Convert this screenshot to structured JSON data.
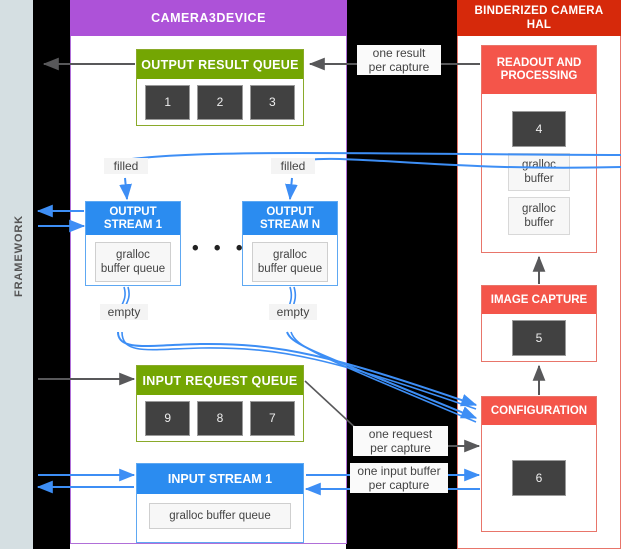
{
  "framework": {
    "label": "FRAMEWORK"
  },
  "camera3device": {
    "title": "CAMERA3DEVICE",
    "output_result_queue": {
      "title": "OUTPUT RESULT QUEUE",
      "slots": [
        "1",
        "2",
        "3"
      ]
    },
    "input_request_queue": {
      "title": "INPUT REQUEST QUEUE",
      "slots": [
        "9",
        "8",
        "7"
      ]
    },
    "output_stream_1": {
      "title_line1": "OUTPUT",
      "title_line2": "STREAM 1",
      "buffer_line1": "gralloc",
      "buffer_line2": "buffer queue"
    },
    "output_stream_n": {
      "title_line1": "OUTPUT",
      "title_line2": "STREAM N",
      "buffer_line1": "gralloc",
      "buffer_line2": "buffer queue"
    },
    "input_stream_1": {
      "title": "INPUT STREAM 1",
      "buffer": "gralloc buffer queue"
    },
    "ellipsis": "• • •"
  },
  "hal": {
    "title_line1": "BINDERIZED CAMERA",
    "title_line2": "HAL",
    "readout": {
      "title_line1": "READOUT AND",
      "title_line2": "PROCESSING",
      "slot": "4",
      "buffer_1_line1": "gralloc",
      "buffer_1_line2": "buffer",
      "buffer_2_line1": "gralloc",
      "buffer_2_line2": "buffer"
    },
    "image_capture": {
      "title": "IMAGE CAPTURE",
      "slot": "5"
    },
    "configuration": {
      "title": "CONFIGURATION",
      "slot": "6"
    }
  },
  "edge_labels": {
    "one_result_line1": "one result",
    "one_result_line2": "per capture",
    "one_request_line1": "one request",
    "one_request_line2": "per capture",
    "one_input_buffer_line1": "one input buffer",
    "one_input_buffer_line2": "per capture",
    "filled_left": "filled",
    "filled_right": "filled",
    "empty_left": "empty",
    "empty_right": "empty"
  },
  "colors": {
    "framework_band": "#d5dfe2",
    "camera_header": "#ad52d8",
    "hal_header": "#d6290b",
    "hal_box": "#f4554a",
    "queue_green": "#74a603",
    "stream_blue": "#2b8cf0",
    "slot_dark": "#414141",
    "arrow_blue": "#3d8ef5",
    "arrow_gray": "#58585a"
  }
}
